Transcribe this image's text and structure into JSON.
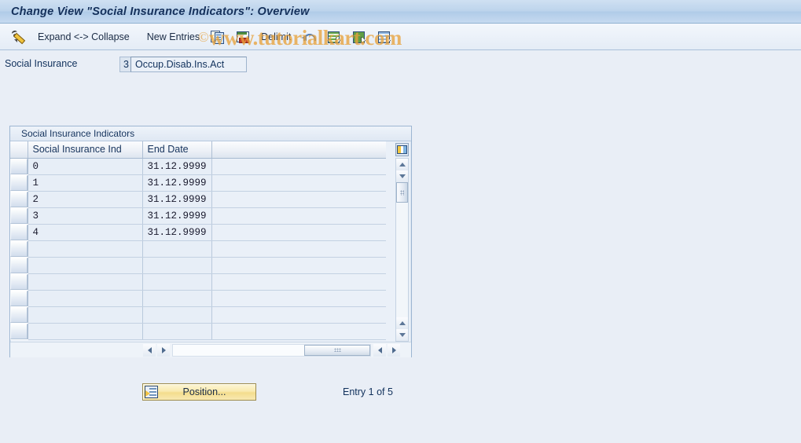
{
  "window": {
    "title": "Change View \"Social Insurance Indicators\": Overview"
  },
  "toolbar": {
    "items": [
      {
        "name": "wand-icon",
        "label": "",
        "icon": "wand-icon"
      },
      {
        "name": "expand-collapse",
        "label": "Expand <-> Collapse",
        "icon": ""
      },
      {
        "name": "new-entries",
        "label": "New Entries",
        "icon": ""
      },
      {
        "name": "copy-as",
        "label": "",
        "icon": "copy-icon"
      },
      {
        "name": "delete-entry",
        "label": "",
        "icon": "delete-row-icon"
      },
      {
        "name": "delimit",
        "label": "Delimit",
        "icon": ""
      },
      {
        "name": "undo",
        "label": "",
        "icon": "undo-arrow-icon"
      },
      {
        "name": "select-all",
        "label": "",
        "icon": "table-select-icon"
      },
      {
        "name": "select-block",
        "label": "",
        "icon": "table-green-icon"
      },
      {
        "name": "deselect-all",
        "label": "",
        "icon": "table-lines-icon"
      }
    ],
    "expand_collapse_label": "Expand <-> Collapse",
    "new_entries_label": "New Entries",
    "delimit_label": "Delimit"
  },
  "watermark": {
    "copyright": "©",
    "text": "www.tutorialkart.com"
  },
  "field": {
    "label": "Social Insurance",
    "key": "3",
    "value": "Occup.Disab.Ins.Act"
  },
  "panel": {
    "title": "Social Insurance Indicators"
  },
  "table": {
    "columns": [
      "Social Insurance Ind",
      "End Date"
    ],
    "rows": [
      {
        "ind": "0",
        "end_date": "31.12.9999"
      },
      {
        "ind": "1",
        "end_date": "31.12.9999"
      },
      {
        "ind": "2",
        "end_date": "31.12.9999"
      },
      {
        "ind": "3",
        "end_date": "31.12.9999"
      },
      {
        "ind": "4",
        "end_date": "31.12.9999"
      },
      {
        "ind": "",
        "end_date": ""
      },
      {
        "ind": "",
        "end_date": ""
      },
      {
        "ind": "",
        "end_date": ""
      },
      {
        "ind": "",
        "end_date": ""
      },
      {
        "ind": "",
        "end_date": ""
      },
      {
        "ind": "",
        "end_date": ""
      }
    ]
  },
  "footer": {
    "position_label": "Position...",
    "entry_status": "Entry 1 of 5"
  },
  "colors": {
    "page_background": "#e9eef6",
    "title_bar": "#bdd4ec",
    "accent_text": "#11315c",
    "watermark": "#e8a33d",
    "button_yellow": "#f4dd8d"
  }
}
